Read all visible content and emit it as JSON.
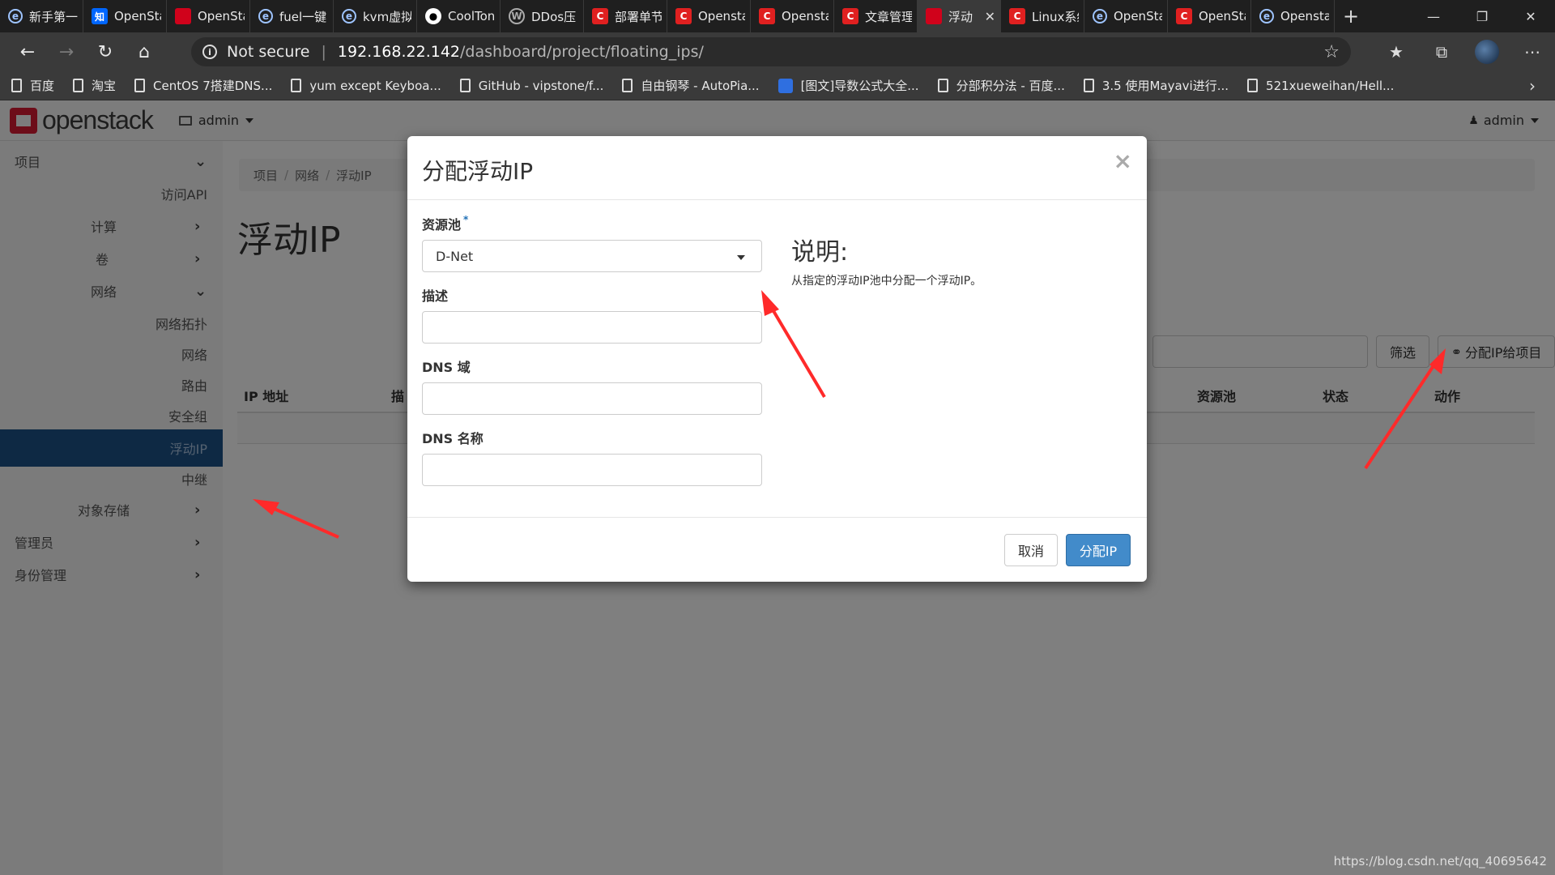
{
  "browser": {
    "tabs": [
      {
        "title": "新手第一",
        "favicon": "edge-icon",
        "active": false
      },
      {
        "title": "OpenSta",
        "favicon": "zhihu-icon",
        "active": false
      },
      {
        "title": "OpenSta",
        "favicon": "openstack-icon",
        "active": false
      },
      {
        "title": "fuel一键",
        "favicon": "edge-icon",
        "active": false
      },
      {
        "title": "kvm虚拟",
        "favicon": "edge-icon",
        "active": false
      },
      {
        "title": "CoolTon",
        "favicon": "github-icon",
        "active": false
      },
      {
        "title": "DDos压",
        "favicon": "wordpress-icon",
        "active": false
      },
      {
        "title": "部署单节",
        "favicon": "csdn-icon",
        "active": false
      },
      {
        "title": "Opensta",
        "favicon": "csdn-icon",
        "active": false
      },
      {
        "title": "Opensta",
        "favicon": "csdn-icon",
        "active": false
      },
      {
        "title": "文章管理",
        "favicon": "csdn-icon",
        "active": false
      },
      {
        "title": "浮动",
        "favicon": "openstack-icon",
        "active": true
      },
      {
        "title": "Linux系统",
        "favicon": "csdn-icon",
        "active": false
      },
      {
        "title": "OpenSta",
        "favicon": "edge-icon",
        "active": false
      },
      {
        "title": "OpenSta",
        "favicon": "csdn-icon",
        "active": false
      },
      {
        "title": "Opensta",
        "favicon": "edge-icon",
        "active": false
      }
    ],
    "address": {
      "security_label": "Not secure",
      "host": "192.168.22.142",
      "path": "/dashboard/project/floating_ips/"
    },
    "bookmarks": [
      {
        "label": "百度",
        "icon": "page-icon"
      },
      {
        "label": "淘宝",
        "icon": "page-icon"
      },
      {
        "label": "CentOS 7搭建DNS...",
        "icon": "page-icon"
      },
      {
        "label": "yum except Keyboa...",
        "icon": "page-icon"
      },
      {
        "label": "GitHub - vipstone/f...",
        "icon": "page-icon"
      },
      {
        "label": "自由钢琴 - AutoPia...",
        "icon": "page-icon"
      },
      {
        "label": "[图文]导数公式大全...",
        "icon": "baidu-paw-icon"
      },
      {
        "label": "分部积分法 - 百度...",
        "icon": "page-icon"
      },
      {
        "label": "3.5 使用Mayavi进行...",
        "icon": "page-icon"
      },
      {
        "label": "521xueweihan/Hell...",
        "icon": "page-icon"
      }
    ]
  },
  "header": {
    "logo_text": "openstack",
    "project": "admin",
    "user": "admin"
  },
  "sidebar": {
    "items": [
      {
        "label": "项目",
        "chevron": "⌄",
        "active": false
      },
      {
        "label": "访问API",
        "chevron": "",
        "active": false
      },
      {
        "label": "计算",
        "chevron": "›",
        "active": false
      },
      {
        "label": "卷",
        "chevron": "›",
        "active": false
      },
      {
        "label": "网络",
        "chevron": "⌄",
        "active": false
      },
      {
        "label": "网络拓扑",
        "chevron": "",
        "active": false
      },
      {
        "label": "网络",
        "chevron": "",
        "active": false
      },
      {
        "label": "路由",
        "chevron": "",
        "active": false
      },
      {
        "label": "安全组",
        "chevron": "",
        "active": false
      },
      {
        "label": "浮动IP",
        "chevron": "",
        "active": true
      },
      {
        "label": "中继",
        "chevron": "",
        "active": false
      },
      {
        "label": "对象存储",
        "chevron": "›",
        "active": false
      },
      {
        "label": "管理员",
        "chevron": "›",
        "active": false
      },
      {
        "label": "身份管理",
        "chevron": "›",
        "active": false
      }
    ]
  },
  "content": {
    "breadcrumb": [
      "项目",
      "网络",
      "浮动IP"
    ],
    "title": "浮动IP",
    "filter_button": "筛选",
    "allocate_button": "分配IP给项目",
    "columns": [
      "IP 地址",
      "描",
      "资源池",
      "状态",
      "动作"
    ]
  },
  "modal": {
    "title": "分配浮动IP",
    "pool_label": "资源池",
    "pool_required_mark": "*",
    "pool_value": "D-Net",
    "description_label": "描述",
    "dns_domain_label": "DNS 域",
    "dns_name_label": "DNS 名称",
    "help_title": "说明:",
    "help_text": "从指定的浮动IP池中分配一个浮动IP。",
    "cancel_label": "取消",
    "submit_label": "分配IP",
    "close_glyph": "×"
  },
  "watermark": "https://blog.csdn.net/qq_40695642",
  "colors": {
    "sidebar_active": "#1c5389",
    "primary_button": "#428bca",
    "annotation_arrow": "#ff2a2a"
  }
}
